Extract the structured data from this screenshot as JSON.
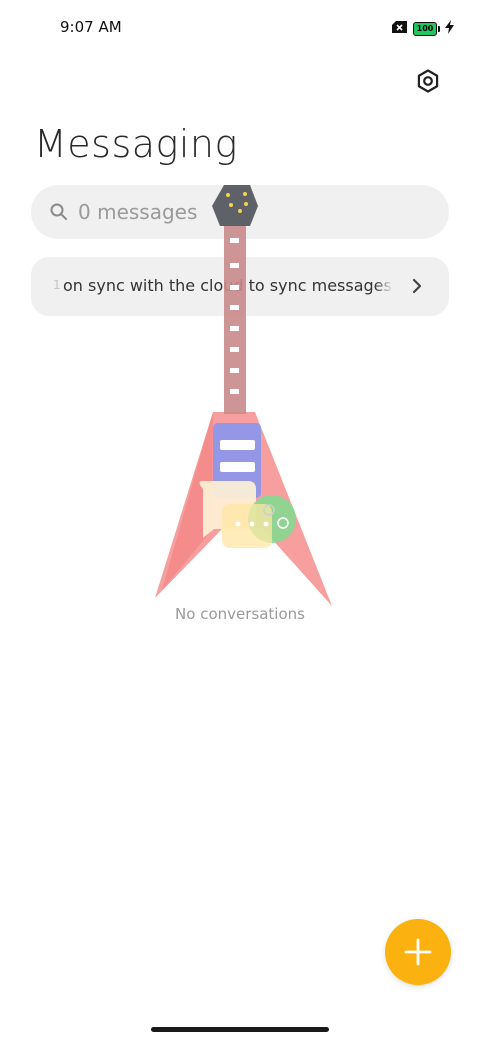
{
  "status_bar": {
    "time": "9:07 AM",
    "battery_level": "100",
    "icons": [
      "no-sim-icon",
      "battery-icon",
      "charging-icon"
    ]
  },
  "header": {
    "title": "Messaging",
    "settings_icon": "gear-icon"
  },
  "search": {
    "placeholder": "0 messages",
    "icon": "search-icon"
  },
  "sync_banner": {
    "leading_fragment": "1",
    "text": "on sync with the cloud to sync messages",
    "icon": "chevron-right-icon"
  },
  "empty_state": {
    "text": "No conversations"
  },
  "fab": {
    "icon": "plus-icon"
  },
  "colors": {
    "accent": "#fbb10f",
    "title": "#2a2a2a",
    "muted_text": "#9a9a9a",
    "surface": "#f0f0f0",
    "battery_fill": "#22c55e"
  }
}
